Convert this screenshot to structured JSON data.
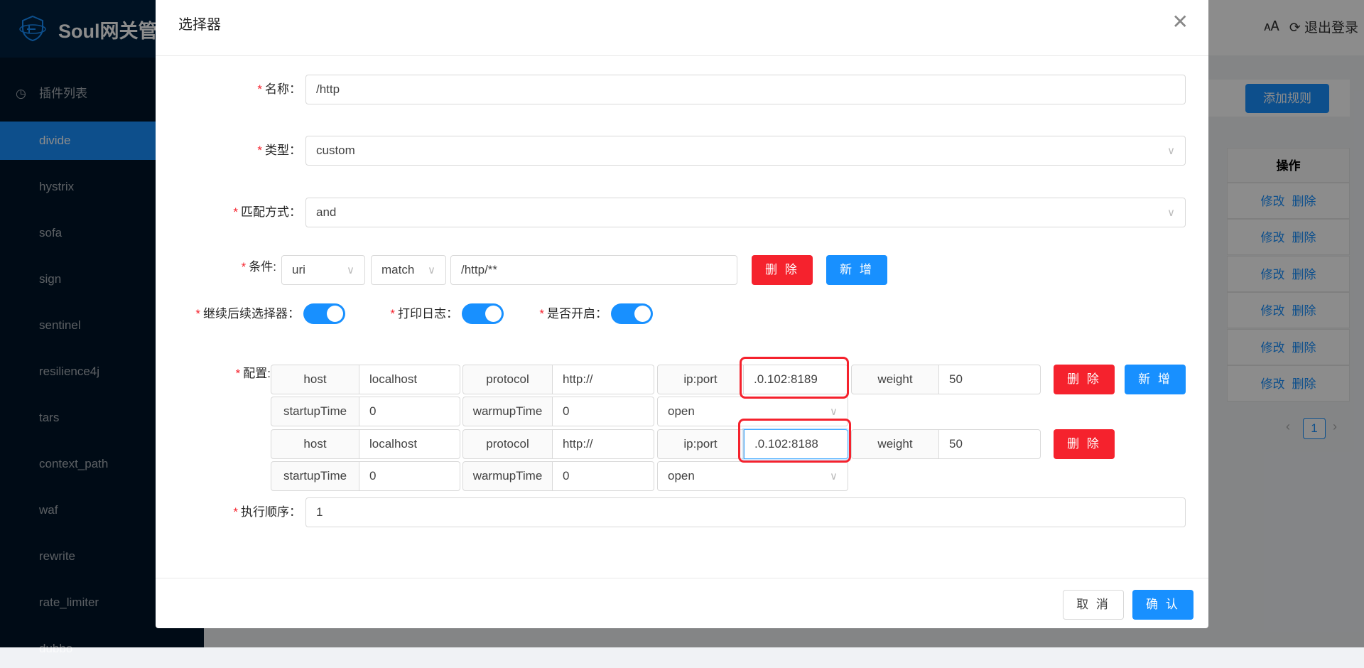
{
  "app": {
    "logo_text": "Soul网关管",
    "logo_icon": "shield-icon"
  },
  "topbar": {
    "lang_icon": "translate-icon",
    "logout_label": "退出登录"
  },
  "sidebar": {
    "section": "插件列表",
    "items": [
      "divide",
      "hystrix",
      "sofa",
      "sign",
      "sentinel",
      "resilience4j",
      "tars",
      "context_path",
      "waf",
      "rewrite",
      "rate_limiter",
      "dubbo"
    ],
    "active": "divide"
  },
  "background": {
    "add_rule_label": "添加规则",
    "table_header": "操作",
    "row_actions": {
      "edit": "修改",
      "delete": "删除"
    },
    "row_count": 6,
    "page": "1"
  },
  "modal": {
    "title": "选择器",
    "fields": {
      "name": {
        "label": "名称：",
        "value": "/http"
      },
      "type": {
        "label": "类型：",
        "value": "custom"
      },
      "match_mode": {
        "label": "匹配方式：",
        "value": "and"
      },
      "execution_order": {
        "label": "执行顺序：",
        "value": "1"
      }
    },
    "condition": {
      "label": "条件:",
      "param_type": "uri",
      "operator": "match",
      "value": "/http/**",
      "delete_label": "删 除",
      "add_label": "新 增"
    },
    "switches": [
      {
        "label": "继续后续选择器：",
        "on": true
      },
      {
        "label": "打印日志：",
        "on": true
      },
      {
        "label": "是否开启：",
        "on": true
      }
    ],
    "config": {
      "label": "配置:",
      "addons": {
        "host": "host",
        "protocol": "protocol",
        "ip_port": "ip:port",
        "weight": "weight",
        "startup": "startupTime",
        "warmup": "warmupTime"
      },
      "rows": [
        {
          "host": "localhost",
          "protocol": "http://",
          "ip_port": ".0.102:8189",
          "weight": "50",
          "startupTime": "0",
          "warmupTime": "0",
          "status": "open"
        },
        {
          "host": "localhost",
          "protocol": "http://",
          "ip_port": ".0.102:8188",
          "weight": "50",
          "startupTime": "0",
          "warmupTime": "0",
          "status": "open"
        }
      ],
      "delete_label": "删 除",
      "add_label": "新 增"
    },
    "footer": {
      "cancel_label": "取 消",
      "confirm_label": "确 认"
    }
  },
  "colors": {
    "primary": "#1890ff",
    "danger": "#f5222d",
    "sidebar": "#001529",
    "highlight": "#f5222d"
  }
}
